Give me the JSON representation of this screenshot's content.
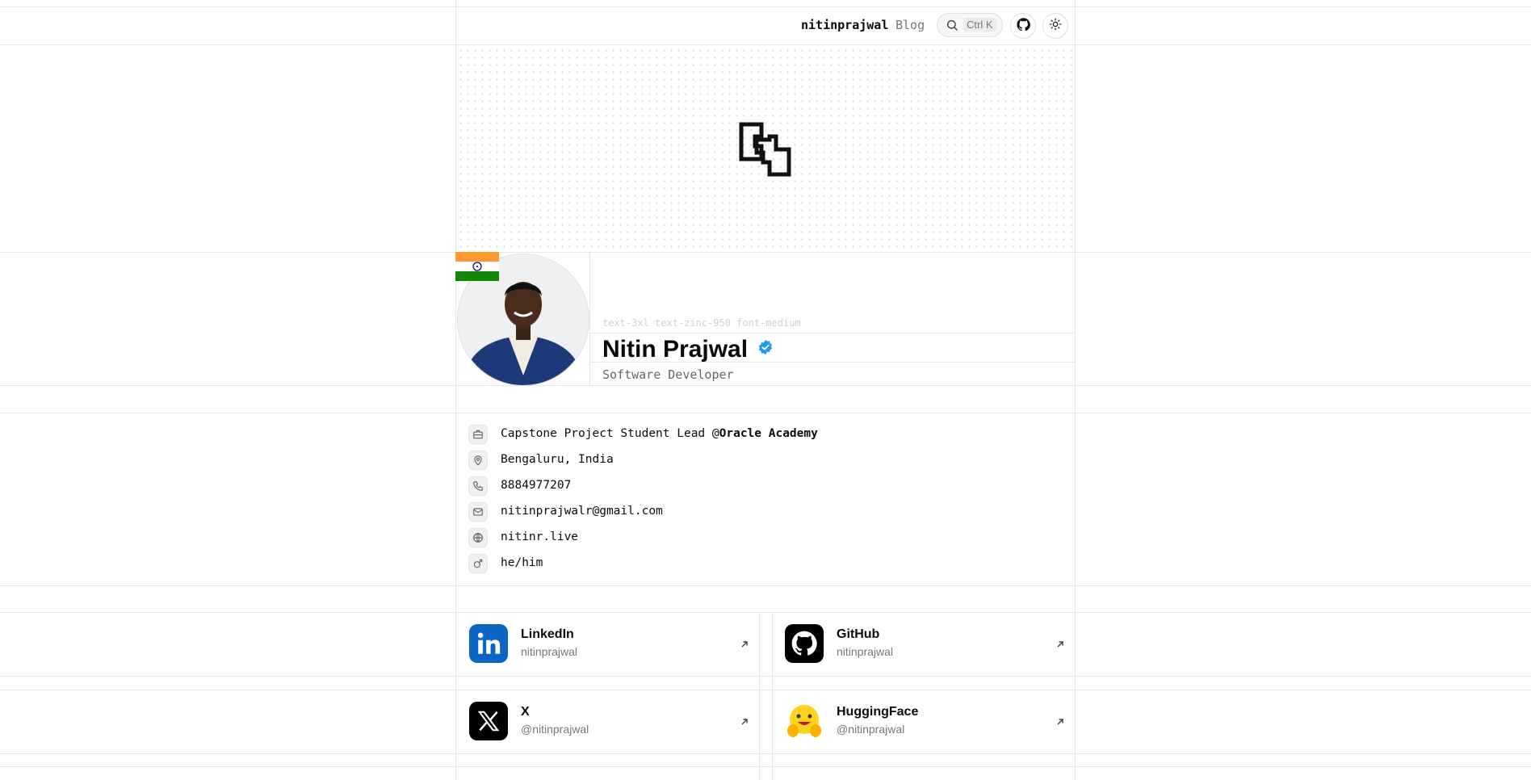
{
  "header": {
    "username": "nitinprajwal",
    "blog_label": "Blog",
    "search_shortcut": "Ctrl K",
    "github_icon": "github-icon",
    "theme_icon": "sun-icon"
  },
  "profile": {
    "class_hint": "text-3xl text-zinc-950 font-medium",
    "name": "Nitin Prajwal",
    "verified_icon": "verified-badge-icon",
    "role": "Software Developer",
    "flag": "india-flag"
  },
  "info": [
    {
      "icon": "briefcase-icon",
      "prefix": "Capstone Project Student Lead @",
      "org": "Oracle Academy"
    },
    {
      "icon": "map-pin-icon",
      "text": "Bengaluru, India"
    },
    {
      "icon": "phone-icon",
      "text": "8884977207"
    },
    {
      "icon": "mail-icon",
      "text": "nitinprajwalr@gmail.com"
    },
    {
      "icon": "globe-icon",
      "text": "nitinr.live"
    },
    {
      "icon": "male-icon",
      "text": "he/him"
    }
  ],
  "social": [
    {
      "name": "LinkedIn",
      "handle": "nitinprajwal",
      "icon": "linkedin-icon",
      "color": "#0a66c2"
    },
    {
      "name": "GitHub",
      "handle": "nitinprajwal",
      "icon": "github-icon",
      "color": "#000000"
    },
    {
      "name": "X",
      "handle": "@nitinprajwal",
      "icon": "x-icon",
      "color": "#000000"
    },
    {
      "name": "HuggingFace",
      "handle": "@nitinprajwal",
      "icon": "huggingface-icon",
      "color": "#ffd21e"
    }
  ]
}
